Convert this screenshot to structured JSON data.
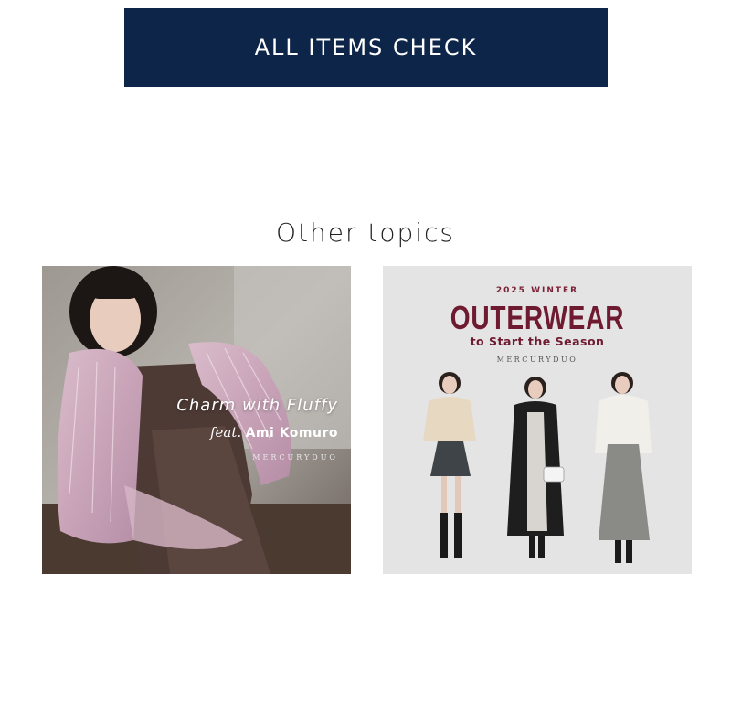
{
  "cta": {
    "label": "ALL ITEMS CHECK",
    "background": "#0d2548"
  },
  "section": {
    "title": "Other topics"
  },
  "topics": [
    {
      "title": "Charm with Fluffy",
      "feat": "feat.",
      "name": "Ami Komuro",
      "brand": "MERCURYDUO"
    },
    {
      "eyebrow": "2025 WINTER",
      "title": "OUTERWEAR",
      "subtitle": "to Start the Season",
      "brand": "MERCURYDUO",
      "accent": "#6e1a30"
    }
  ]
}
